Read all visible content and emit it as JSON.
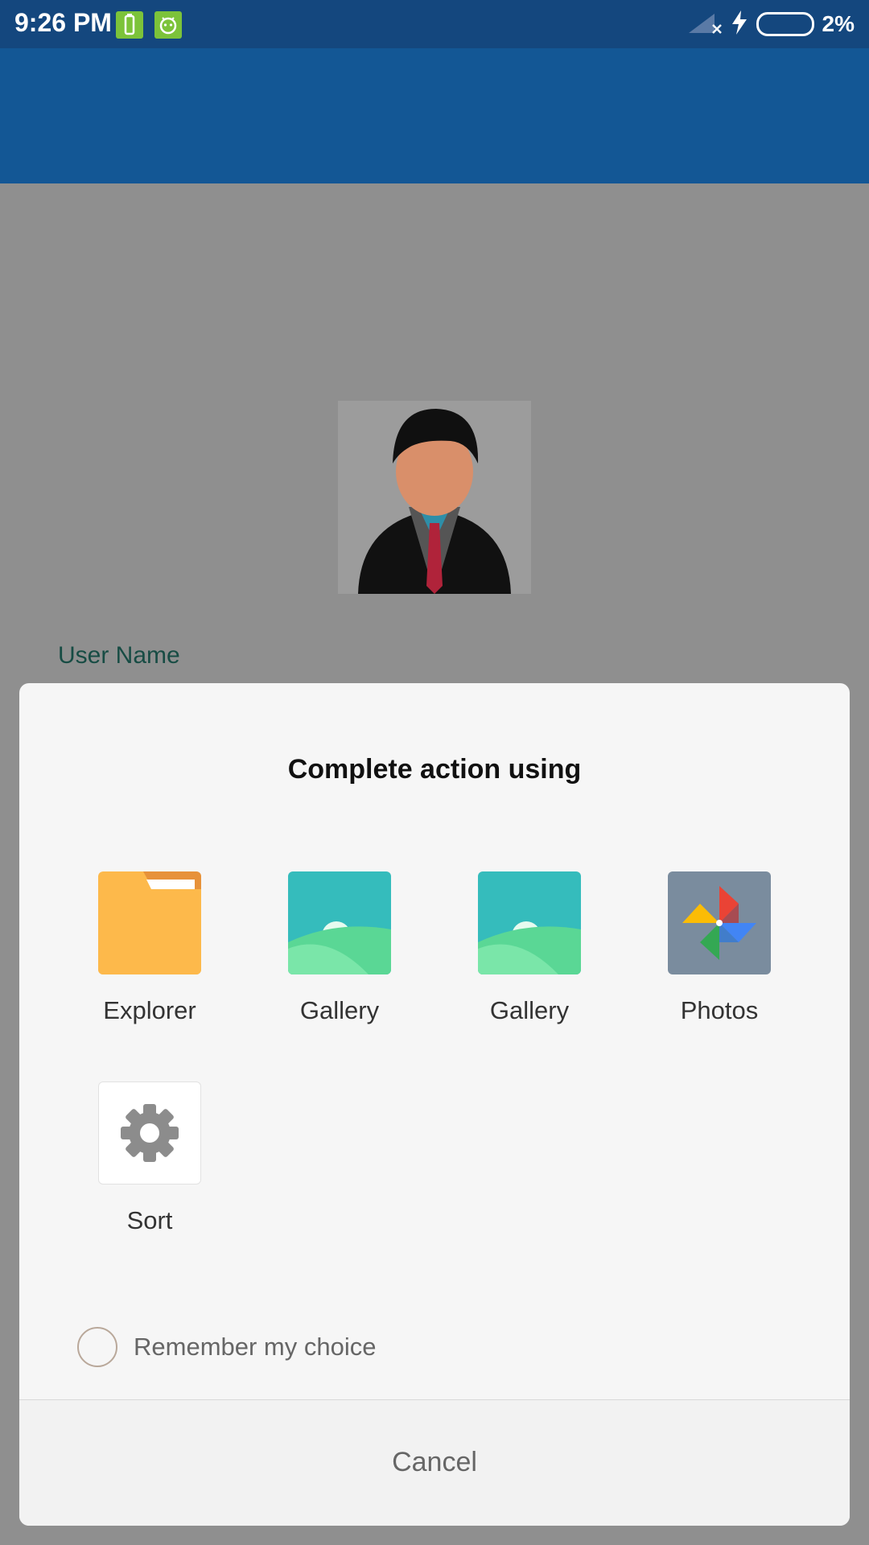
{
  "status_bar": {
    "time": "9:26 PM",
    "battery": "2%",
    "icons": [
      "battery-saver-icon",
      "android-icon",
      "signal-icon",
      "charging-icon",
      "battery-icon"
    ]
  },
  "profile": {
    "username_label": "User Name"
  },
  "dialog": {
    "title": "Complete action using",
    "apps": [
      {
        "label": "Explorer",
        "icon": "folder-icon"
      },
      {
        "label": "Gallery",
        "icon": "gallery-icon"
      },
      {
        "label": "Gallery",
        "icon": "gallery-icon"
      },
      {
        "label": "Photos",
        "icon": "pinwheel-icon"
      },
      {
        "label": "Sort",
        "icon": "gear-icon"
      }
    ],
    "remember_label": "Remember my choice",
    "cancel_label": "Cancel"
  },
  "colors": {
    "status_bar": "#14477e",
    "app_bar": "#135795",
    "scrim": "#8f8f8f",
    "dialog_bg": "#f6f6f6",
    "folder": "#fdb94b",
    "gallery_sky": "#35bcbc"
  }
}
